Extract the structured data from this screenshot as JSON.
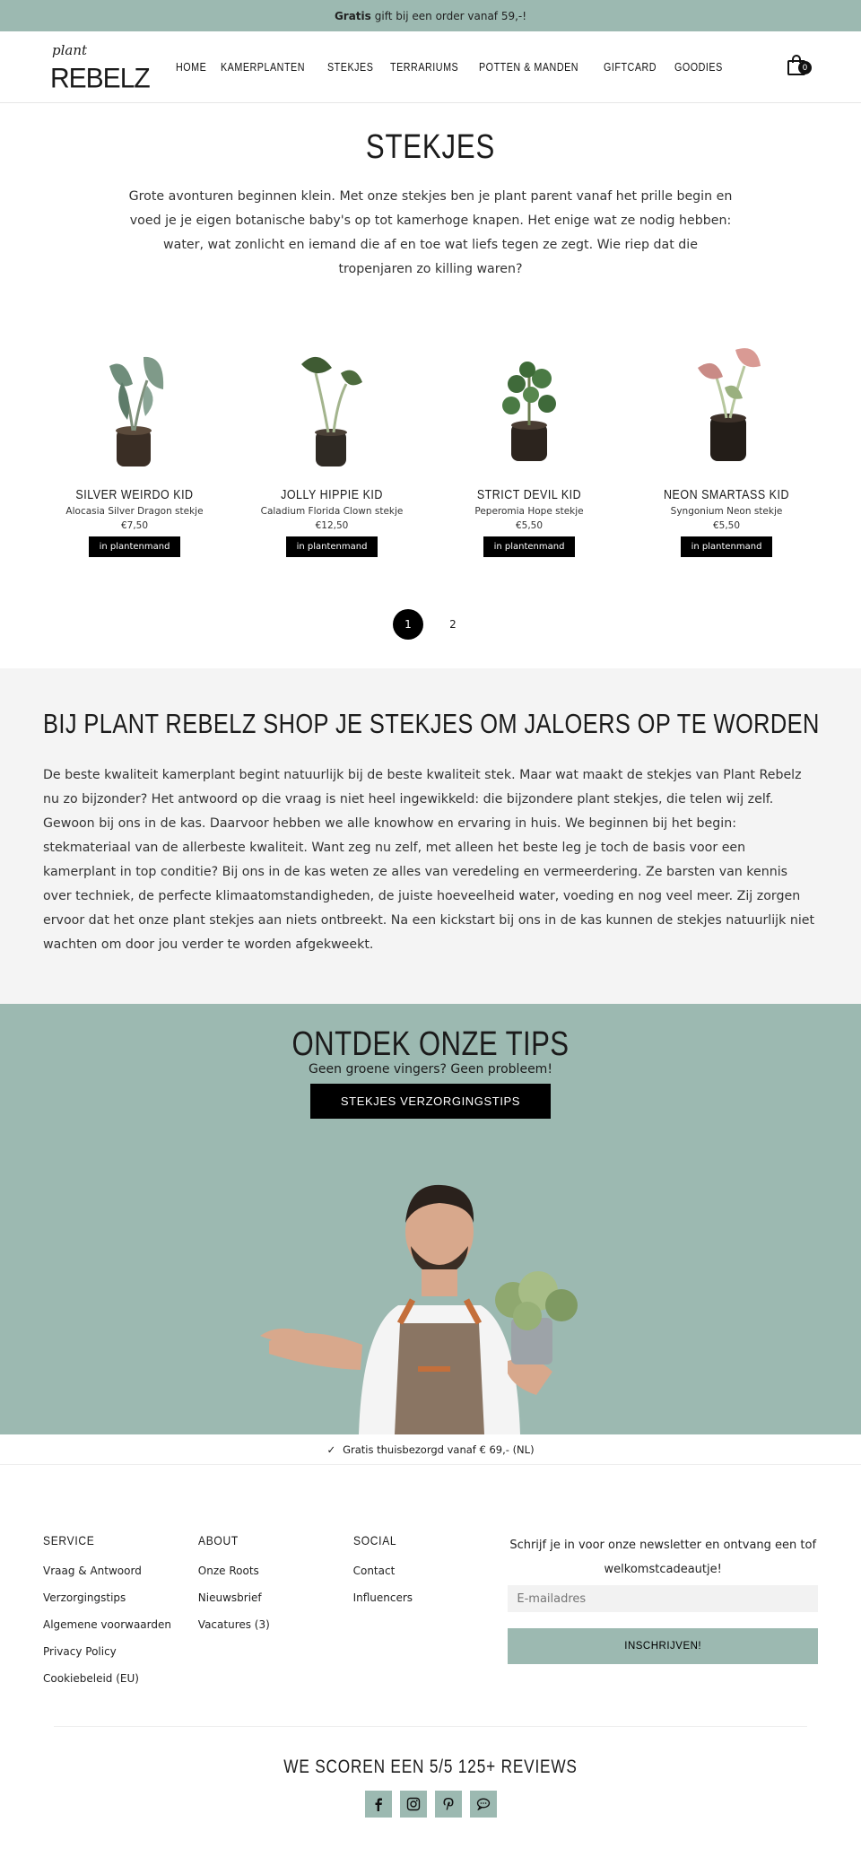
{
  "topbar": {
    "bold": "Gratis",
    "text": "gift bij een order vanaf 59,-!"
  },
  "logo": {
    "top": "plant",
    "bottom": "REBELZ"
  },
  "nav": [
    "HOME",
    "KAMERPLANTEN",
    "STEKJES",
    "TERRARIUMS",
    "POTTEN & MANDEN",
    "GIFTCARD",
    "GOODIES"
  ],
  "cart": {
    "count": "0"
  },
  "page_title": "STEKJES",
  "intro": "Grote avonturen beginnen klein. Met onze stekjes ben je plant parent vanaf het prille begin en voed je je eigen botanische baby's op tot kamerhoge knapen. Het enige wat ze nodig hebben: water, wat zonlicht en iemand die af en toe wat liefs tegen ze zegt. Wie riep dat die tropenjaren zo killing waren?",
  "products": [
    {
      "name": "SILVER WEIRDO KID",
      "sub": "Alocasia Silver Dragon stekje",
      "price": "€7,50",
      "button": "in plantenmand"
    },
    {
      "name": "JOLLY HIPPIE KID",
      "sub": "Caladium Florida Clown stekje",
      "price": "€12,50",
      "button": "in plantenmand"
    },
    {
      "name": "STRICT DEVIL KID",
      "sub": "Peperomia Hope stekje",
      "price": "€5,50",
      "button": "in plantenmand"
    },
    {
      "name": "NEON SMARTASS KID",
      "sub": "Syngonium Neon stekje",
      "price": "€5,50",
      "button": "in plantenmand"
    }
  ],
  "pagination": [
    "1",
    "2"
  ],
  "about": {
    "title": "BIJ PLANT REBELZ SHOP JE STEKJES OM JALOERS OP TE WORDEN",
    "text": "De beste kwaliteit kamerplant begint natuurlijk bij de beste kwaliteit stek. Maar wat maakt de stekjes van Plant Rebelz nu zo bijzonder? Het antwoord op die vraag is niet heel ingewikkeld: die bijzondere plant stekjes, die telen wij zelf. Gewoon bij ons in de kas. Daarvoor hebben we alle knowhow en ervaring in huis. We beginnen bij het begin: stekmateriaal van de allerbeste kwaliteit. Want zeg nu zelf, met alleen het beste leg je toch de basis voor een kamerplant in top conditie? Bij ons in de kas weten ze alles van veredeling en vermeerdering. Ze barsten van kennis over techniek, de perfecte klimaatomstandigheden, de juiste hoeveelheid water, voeding en nog veel meer. Zij zorgen ervoor dat het onze plant stekjes aan niets ontbreekt. Na een kickstart bij ons in de kas kunnen de stekjes natuurlijk niet wachten om door jou verder te worden afgekweekt."
  },
  "tips": {
    "title": "ONTDEK ONZE TIPS",
    "sub": "Geen groene vingers? Geen probleem!",
    "button": "STEKJES VERZORGINGSTIPS"
  },
  "shipping": "Gratis thuisbezorgd vanaf € 69,- (NL)",
  "footer": {
    "service": {
      "title": "SERVICE",
      "links": [
        "Vraag & Antwoord",
        "Verzorgingstips",
        "Algemene voorwaarden",
        "Privacy Policy",
        "Cookiebeleid (EU)"
      ]
    },
    "about": {
      "title": "ABOUT",
      "links": [
        "Onze Roots",
        "Nieuwsbrief",
        "Vacatures (3)"
      ]
    },
    "social": {
      "title": "SOCIAL",
      "links": [
        "Contact",
        "Influencers"
      ]
    },
    "newsletter": {
      "text": "Schrijf je in voor onze newsletter en ontvang een tof welkomstcadeautje!",
      "placeholder": "E-mailadres",
      "button": "INSCHRIJVEN!"
    }
  },
  "reviews": "WE SCOREN EEN 5/5 125+ REVIEWS",
  "colors": {
    "accent": "#9cb9b1",
    "dark": "#000000"
  }
}
